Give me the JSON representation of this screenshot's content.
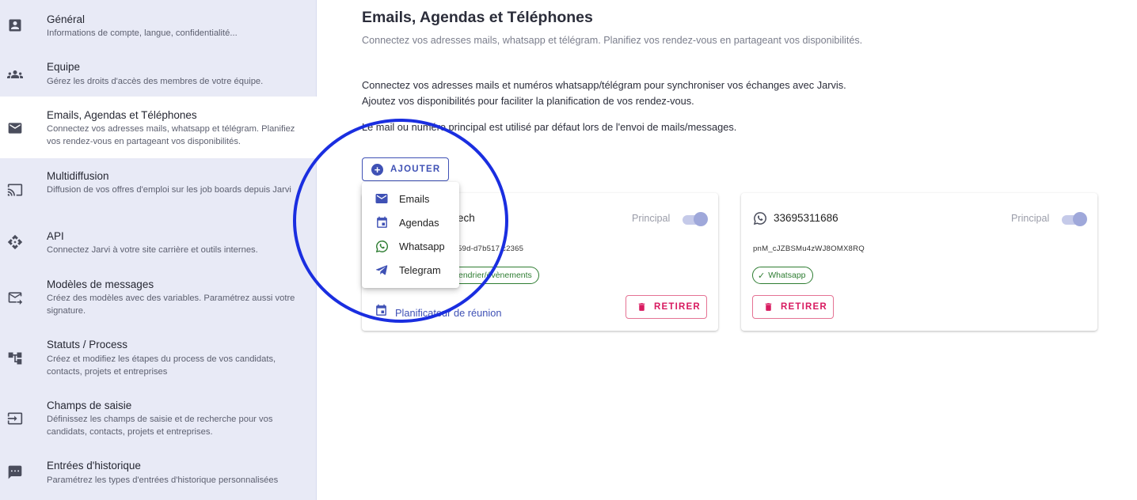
{
  "sidebar": {
    "items": [
      {
        "title": "Général",
        "desc": "Informations de compte, langue, confidentialité...",
        "icon": "account-box-icon"
      },
      {
        "title": "Equipe",
        "desc": "Gérez les droits d'accès des membres de votre équipe.",
        "icon": "group-icon"
      },
      {
        "title": "Emails, Agendas et Téléphones",
        "desc": "Connectez vos adresses mails, whatsapp et télégram. Planifiez vos rendez-vous en partageant vos disponibilités.",
        "icon": "mail-icon"
      },
      {
        "title": "Multidiffusion",
        "desc": "Diffusion de vos offres d'emploi sur les job boards depuis Jarvi",
        "icon": "cast-icon"
      },
      {
        "title": "API",
        "desc": "Connectez Jarvi à votre site carrière et outils internes.",
        "icon": "api-icon"
      },
      {
        "title": "Modèles de messages",
        "desc": "Créez des modèles avec des variables. Paramétrez aussi votre signature.",
        "icon": "mail-template-icon"
      },
      {
        "title": "Statuts / Process",
        "desc": "Créez et modifiez les étapes du process de vos candidats, contacts, projets et entreprises",
        "icon": "account-tree-icon"
      },
      {
        "title": "Champs de saisie",
        "desc": "Définissez les champs de saisie et de recherche pour vos candidats, contacts, projets et entreprises.",
        "icon": "input-icon"
      },
      {
        "title": "Entrées d'historique",
        "desc": "Paramétrez les types d'entrées d'historique personnalisées",
        "icon": "comment-icon"
      }
    ]
  },
  "main": {
    "title": "Emails, Agendas et Téléphones",
    "subtitle": "Connectez vos adresses mails, whatsapp et télégram. Planifiez vos rendez-vous en partageant vos disponibilités.",
    "para1": "Connectez vos adresses mails et numéros whatsapp/télégram pour synchroniser vos échanges avec Jarvis.",
    "para2": "Ajoutez vos disponibilités pour faciliter la planification de vos rendez-vous.",
    "para3": "Le mail ou numéro principal est utilisé par défaut lors de l'envoi de mails/messages.",
    "add_label": "AJOUTER"
  },
  "menu": {
    "items": [
      {
        "label": "Emails",
        "icon": "email-icon"
      },
      {
        "label": "Agendas",
        "icon": "calendar-icon"
      },
      {
        "label": "Whatsapp",
        "icon": "whatsapp-icon"
      },
      {
        "label": "Telegram",
        "icon": "telegram-icon"
      }
    ]
  },
  "cards": [
    {
      "name": "ech",
      "id": "59d-d7b517 c2365",
      "principal_label": "Principal",
      "principal_on": true,
      "chip": "endrier/évènements",
      "meeting_label": "Planificateur de réunion",
      "remove_label": "RETIRER"
    },
    {
      "name": "33695311686",
      "id": "pnM_cJZBSMu4zWJ8OMX8RQ",
      "principal_label": "Principal",
      "principal_on": true,
      "chip": "Whatsapp",
      "remove_label": "RETIRER"
    }
  ],
  "colors": {
    "primary": "#3f51b5",
    "danger": "#d81b60",
    "success": "#2e7d32",
    "sidebar_bg": "#e8eaf6",
    "annotation": "#1a2ee0"
  }
}
